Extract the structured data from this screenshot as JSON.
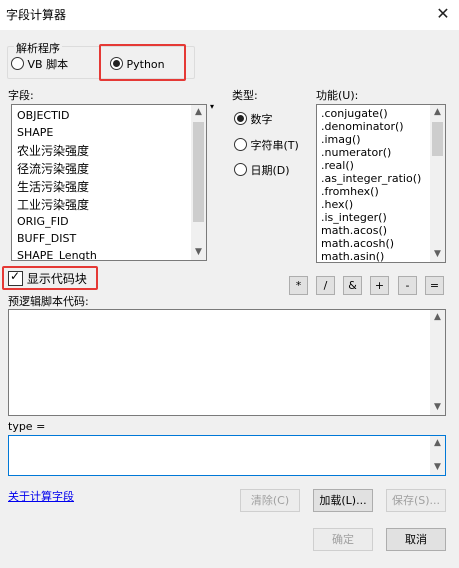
{
  "window": {
    "title": "字段计算器"
  },
  "parser": {
    "group_label": "解析程序",
    "options": [
      {
        "label": "VB 脚本",
        "selected": false
      },
      {
        "label": "Python",
        "selected": true
      }
    ]
  },
  "fields": {
    "label": "字段:",
    "items": [
      "OBJECTID",
      "SHAPE",
      "农业污染强度",
      "径流污染强度",
      "生活污染强度",
      "工业污染强度",
      "ORIG_FID",
      "BUFF_DIST",
      "SHAPE_Length"
    ]
  },
  "type": {
    "label": "类型:",
    "options": [
      {
        "label": "数字",
        "selected": true
      },
      {
        "label": "字符串(T)",
        "selected": false
      },
      {
        "label": "日期(D)",
        "selected": false
      }
    ]
  },
  "functions": {
    "label": "功能(U):",
    "items": [
      ".conjugate()",
      ".denominator()",
      ".imag()",
      ".numerator()",
      ".real()",
      ".as_integer_ratio()",
      ".fromhex()",
      ".hex()",
      ".is_integer()",
      "math.acos()",
      "math.acosh()",
      "math.asin()"
    ]
  },
  "show_codeblock": {
    "label": "显示代码块",
    "checked": true
  },
  "operators": [
    "*",
    "/",
    "&",
    "+",
    "-",
    "="
  ],
  "prelogic": {
    "label": "预逻辑脚本代码:",
    "value": ""
  },
  "expression": {
    "label": "type =",
    "value": ""
  },
  "help_link": "关于计算字段",
  "buttons": {
    "clear": "清除(C)",
    "load": "加载(L)...",
    "save": "保存(S)...",
    "ok": "确定",
    "cancel": "取消"
  }
}
